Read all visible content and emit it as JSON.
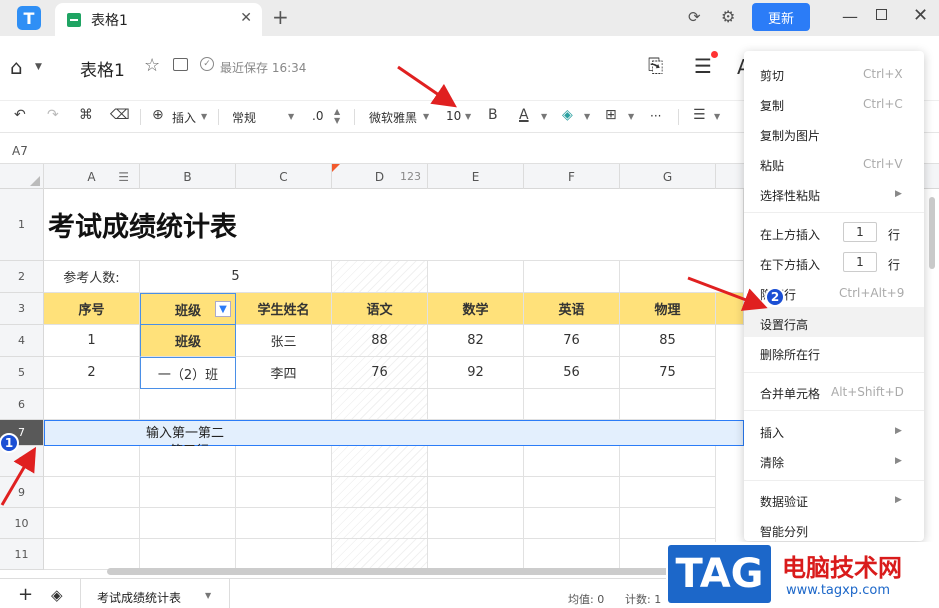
{
  "titlebar": {
    "tab_title": "表格1",
    "update_label": "更新"
  },
  "header": {
    "doc_title": "表格1",
    "save_status": "最近保存 16:34"
  },
  "toolbar": {
    "insert_label": "插入",
    "format_label": "常规",
    "decimal_label": ".0",
    "font_name": "微软雅黑",
    "font_size": "10",
    "bold": "B",
    "font_color": "A",
    "more": "···"
  },
  "namebox": "A7",
  "columns": [
    "A",
    "B",
    "C",
    "D",
    "E",
    "F",
    "G"
  ],
  "d_col_badge": "123",
  "rows": [
    "1",
    "2",
    "3",
    "4",
    "5",
    "6",
    "7",
    "8",
    "9",
    "10",
    "11"
  ],
  "sheet": {
    "title": "考试成绩统计表",
    "count_label": "参考人数:",
    "count_value": "5",
    "headers": [
      "序号",
      "班级",
      "学生姓名",
      "语文",
      "数学",
      "英语",
      "物理"
    ],
    "data_rows": [
      [
        "1",
        "班级",
        "张三",
        "88",
        "82",
        "76",
        "85"
      ],
      [
        "2",
        "一（2）班",
        "李四",
        "76",
        "92",
        "56",
        "75"
      ]
    ],
    "row7_text": "输入第一第二",
    "row7_text2": "第三行"
  },
  "context_menu": {
    "items": [
      {
        "label": "剪切",
        "shortcut": "Ctrl+X"
      },
      {
        "label": "复制",
        "shortcut": "Ctrl+C"
      },
      {
        "label": "复制为图片",
        "shortcut": ""
      },
      {
        "label": "粘贴",
        "shortcut": "Ctrl+V"
      },
      {
        "label": "选择性粘贴",
        "shortcut": ""
      },
      {
        "label": "在上方插入",
        "value": "1",
        "unit": "行"
      },
      {
        "label": "在下方插入",
        "value": "1",
        "unit": "行"
      },
      {
        "label": "隐藏行",
        "shortcut": "Ctrl+Alt+9"
      },
      {
        "label": "设置行高",
        "shortcut": ""
      },
      {
        "label": "删除所在行",
        "shortcut": ""
      },
      {
        "label": "合并单元格",
        "shortcut": "Alt+Shift+D"
      },
      {
        "label": "插入",
        "shortcut": ""
      },
      {
        "label": "清除",
        "shortcut": ""
      },
      {
        "label": "数据验证",
        "shortcut": ""
      },
      {
        "label": "智能分列",
        "shortcut": ""
      }
    ]
  },
  "bottom": {
    "sheet_tab": "考试成绩统计表",
    "avg": "均值: 0",
    "count": "计数: 1"
  },
  "badges": [
    "1",
    "2"
  ],
  "watermark": {
    "tag": "TAG",
    "name": "电脑技术网",
    "url": "www.tagxp.com"
  },
  "colors": {
    "header_yellow": "#ffe17a",
    "accent_blue": "#2b7cf7",
    "arrow_red": "#e02020"
  }
}
